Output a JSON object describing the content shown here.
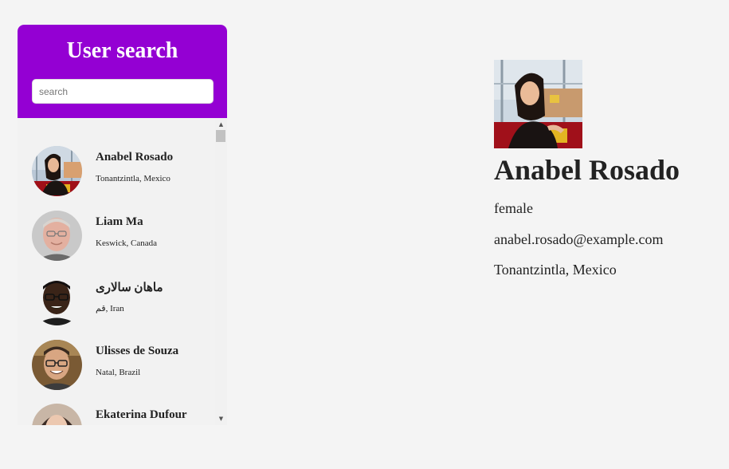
{
  "search_panel": {
    "title": "User search",
    "search_placeholder": "search",
    "search_value": ""
  },
  "users": [
    {
      "name": "Anabel Rosado",
      "location": "Tonantzintla, Mexico"
    },
    {
      "name": "Liam Ma",
      "location": "Keswick, Canada"
    },
    {
      "name": "ماهان سالاری",
      "location": "قم, Iran"
    },
    {
      "name": "Ulisses de Souza",
      "location": "Natal, Brazil"
    },
    {
      "name": "Ekaterina Dufour",
      "location": ""
    }
  ],
  "selected_user": {
    "name": "Anabel Rosado",
    "gender": "female",
    "email": "anabel.rosado@example.com",
    "location": "Tonantzintla, Mexico"
  },
  "colors": {
    "header": "#9400d3",
    "background": "#f4f4f4"
  },
  "icons": {
    "scroll_up": "scroll-up-arrow-icon",
    "scroll_down": "scroll-down-arrow-icon"
  }
}
